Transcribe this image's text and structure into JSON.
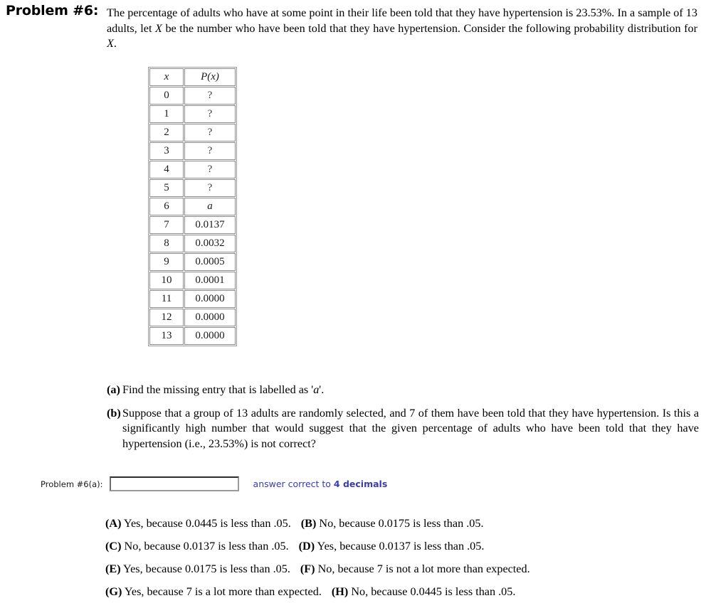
{
  "problem": {
    "header": "Problem #6:",
    "intro_parts": {
      "before_var": "The percentage of adults who have at some point in their life been told that they have hypertension is 23.53%. In a sample of 13 adults, let ",
      "var1": "X",
      "middle": " be the number who have been told that they have hypertension. Consider the following probability distribution for ",
      "var2": "X",
      "after": "."
    },
    "percentage": "23.53%",
    "sample_size": "13",
    "random_variable": "X"
  },
  "prob_table": {
    "headers": [
      "x",
      "P(x)"
    ],
    "rows": [
      {
        "x": "0",
        "p": "?"
      },
      {
        "x": "1",
        "p": "?"
      },
      {
        "x": "2",
        "p": "?"
      },
      {
        "x": "3",
        "p": "?"
      },
      {
        "x": "4",
        "p": "?"
      },
      {
        "x": "5",
        "p": "?"
      },
      {
        "x": "6",
        "p": "a"
      },
      {
        "x": "7",
        "p": "0.0137"
      },
      {
        "x": "8",
        "p": "0.0032"
      },
      {
        "x": "9",
        "p": "0.0005"
      },
      {
        "x": "10",
        "p": "0.0001"
      },
      {
        "x": "11",
        "p": "0.0000"
      },
      {
        "x": "12",
        "p": "0.0000"
      },
      {
        "x": "13",
        "p": "0.0000"
      }
    ]
  },
  "parts": [
    {
      "tag": "(a)",
      "before_var": "Find the missing entry that is labelled as '",
      "var": "a",
      "after_var": "'."
    },
    {
      "tag": "(b)",
      "before_var": "Suppose that a group of 13 adults are randomly selected, and 7 of them have been told that they have hypertension. Is this a significantly high number that would suggest that the given percentage of adults who have been told that they have hypertension (i.e., 23.53%) is not correct?",
      "var": "",
      "after_var": ""
    }
  ],
  "answer": {
    "label": "Problem #6(a):",
    "value": "",
    "placeholder": "",
    "note_prefix": "answer correct to ",
    "note_emphasis": "4 decimals"
  },
  "choices": [
    [
      {
        "tag": "(A)",
        "text": "Yes, because 0.0445 is less than .05."
      },
      {
        "tag": "(B)",
        "text": "No, because 0.0175 is less than .05."
      }
    ],
    [
      {
        "tag": "(C)",
        "text": "No, because 0.0137 is less than .05."
      },
      {
        "tag": "(D)",
        "text": "Yes, because 0.0137 is less than .05."
      }
    ],
    [
      {
        "tag": "(E)",
        "text": "Yes, because 0.0175 is less than .05."
      },
      {
        "tag": "(F)",
        "text": "No, because 7 is not a lot more than expected."
      }
    ],
    [
      {
        "tag": "(G)",
        "text": "Yes, because 7 is a lot more than expected."
      },
      {
        "tag": "(H)",
        "text": "No, because 0.0445 is less than .05."
      }
    ]
  ],
  "colors": {
    "accent_blue": "#3b3bab",
    "text": "#000000",
    "table_border": "#8c8c8c"
  }
}
